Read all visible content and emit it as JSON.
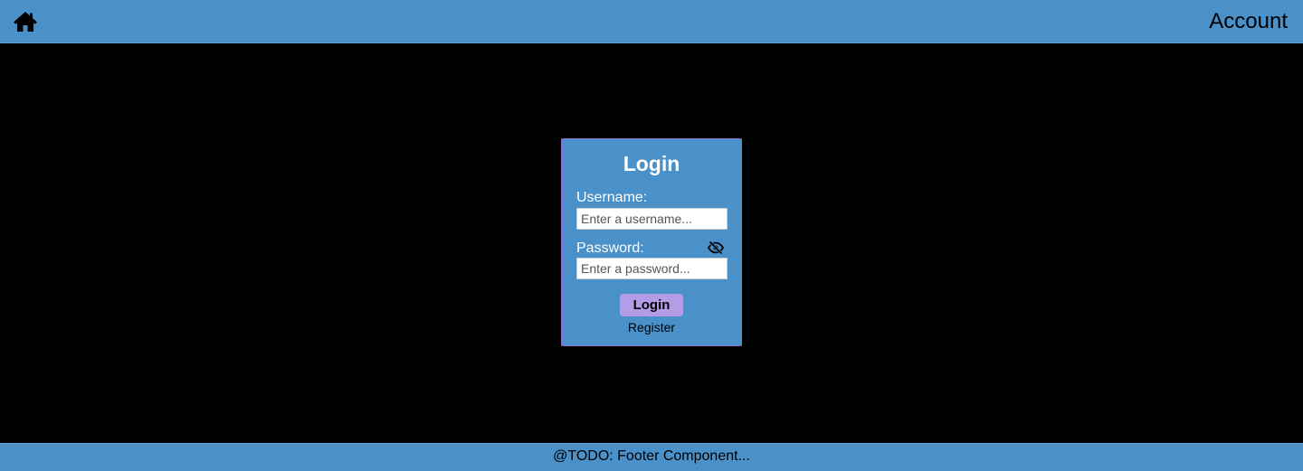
{
  "header": {
    "home_icon": "home-icon",
    "account_label": "Account"
  },
  "login_form": {
    "title": "Login",
    "username_label": "Username:",
    "username_placeholder": "Enter a username...",
    "username_value": "",
    "password_label": "Password:",
    "password_placeholder": "Enter a password...",
    "password_value": "",
    "password_visibility_icon": "eye-slash-icon",
    "submit_label": "Login",
    "register_label": "Register"
  },
  "footer": {
    "text": "@TODO: Footer Component..."
  },
  "colors": {
    "bar": "#4a90c9",
    "background": "#000000",
    "card_border": "#a06bd8",
    "login_button": "#b39de6"
  }
}
